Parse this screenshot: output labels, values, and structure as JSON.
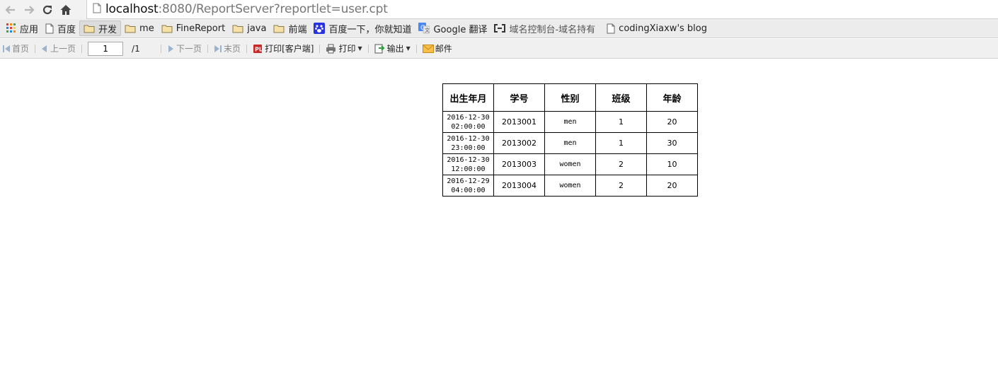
{
  "browser": {
    "url_host": "localhost",
    "url_rest": ":8080/ReportServer?reportlet=user.cpt",
    "bookmarks": [
      {
        "label": "应用",
        "icon": "apps-grid-icon"
      },
      {
        "label": "百度",
        "icon": "page-icon"
      },
      {
        "label": "开发",
        "icon": "folder-icon"
      },
      {
        "label": "me",
        "icon": "folder-icon"
      },
      {
        "label": "FineReport",
        "icon": "folder-icon"
      },
      {
        "label": "java",
        "icon": "folder-icon"
      },
      {
        "label": "前端",
        "icon": "folder-icon"
      },
      {
        "label": "百度一下，你就知道",
        "icon": "baidu-paw-icon"
      },
      {
        "label": "Google 翻译",
        "icon": "google-translate-icon"
      },
      {
        "label": "域名控制台-域名持有",
        "icon": "aliyun-icon"
      },
      {
        "label": "codingXiaxw's blog",
        "icon": "page-icon"
      }
    ]
  },
  "toolbar": {
    "first": "首页",
    "prev": "上一页",
    "page_value": "1",
    "page_total": "/1",
    "next": "下一页",
    "last": "末页",
    "print_client": "打印[客户端]",
    "print": "打印",
    "export": "输出",
    "mail": "邮件"
  },
  "report": {
    "headers": [
      "出生年月",
      "学号",
      "性别",
      "班级",
      "年龄"
    ],
    "rows": [
      {
        "birth_date": "2016-12-30",
        "birth_time": "02:00:00",
        "id": "2013001",
        "gender": "men",
        "class": "1",
        "age": "20"
      },
      {
        "birth_date": "2016-12-30",
        "birth_time": "23:00:00",
        "id": "2013002",
        "gender": "men",
        "class": "1",
        "age": "30"
      },
      {
        "birth_date": "2016-12-30",
        "birth_time": "12:00:00",
        "id": "2013003",
        "gender": "women",
        "class": "2",
        "age": "10"
      },
      {
        "birth_date": "2016-12-29",
        "birth_time": "04:00:00",
        "id": "2013004",
        "gender": "women",
        "class": "2",
        "age": "20"
      }
    ]
  }
}
